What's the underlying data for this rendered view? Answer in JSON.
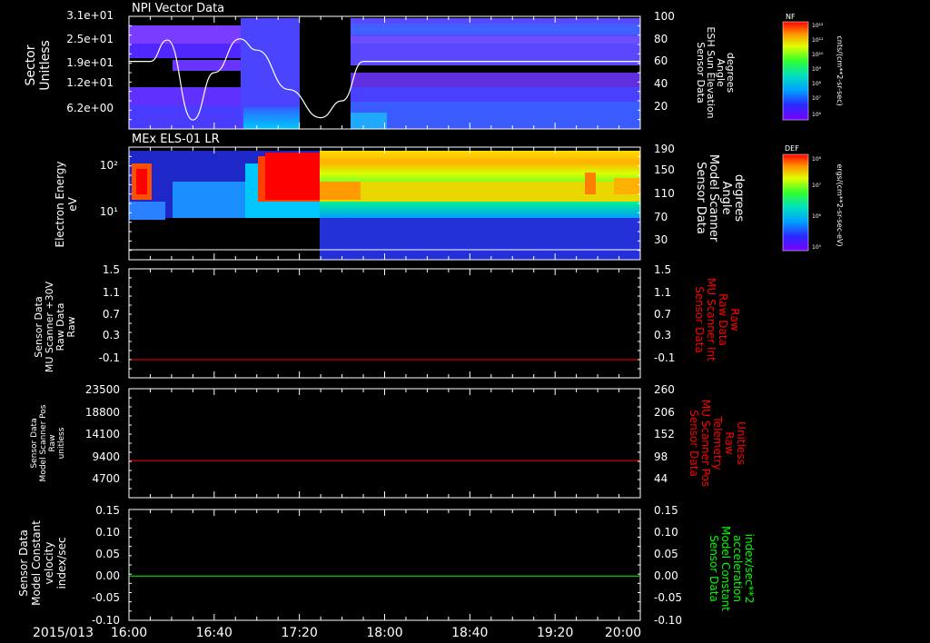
{
  "date_label": "2015/013",
  "time_ticks": [
    "16:00",
    "16:40",
    "17:20",
    "18:00",
    "18:40",
    "19:20",
    "20:00"
  ],
  "colors": {
    "white": "#ffffff",
    "red": "#ff0000",
    "green": "#00ff00",
    "background": "#000000"
  },
  "chart_data": [
    {
      "type": "heatmap",
      "title": "NPI Vector Data",
      "ylabel_left": [
        "Sector",
        "Unitless"
      ],
      "yticks_left": [
        "3.1e+01",
        "2.5e+01",
        "1.9e+01",
        "1.2e+01",
        "6.2e+00"
      ],
      "ylabel_right": [
        "Sensor Data",
        "ESH Sun Elevation",
        "Angle",
        "degrees"
      ],
      "yticks_right": [
        "100",
        "80",
        "60",
        "40",
        "20"
      ],
      "colorbar": {
        "label": "NF",
        "tick_labels": [
          "10¹²",
          "10¹¹",
          "10¹⁰",
          "10⁹",
          "10⁸",
          "10⁷",
          "10⁶"
        ],
        "units": "cnts/(cm**2-sr-sec)"
      },
      "overlay_line": {
        "name": "ESH Sun Elevation Angle",
        "x_time": [
          "16:00",
          "16:10",
          "16:18",
          "16:30",
          "16:40",
          "16:52",
          "17:00",
          "17:15",
          "17:30",
          "17:40",
          "17:50",
          "18:00",
          "20:00"
        ],
        "y_deg": [
          60,
          60,
          79,
          8,
          50,
          80,
          70,
          35,
          10,
          25,
          60,
          60,
          60
        ],
        "range": [
          0,
          100
        ]
      },
      "data_gap": {
        "start": "17:20",
        "end": "17:40"
      }
    },
    {
      "type": "heatmap",
      "title": "MEx ELS-01 LR",
      "ylabel_left": [
        "Electron Energy",
        "eV"
      ],
      "yticks_left": [
        "10²",
        "10¹"
      ],
      "ylabel_right": [
        "Sensor Data",
        "Model Scanner",
        "Angle",
        "degrees"
      ],
      "yticks_right": [
        "190",
        "150",
        "110",
        "70",
        "30"
      ],
      "colorbar": {
        "label": "DEF",
        "tick_labels": [
          "10⁸",
          "10⁷",
          "10⁶",
          "10⁵"
        ],
        "units": "ergs/(cm**2-sr-sec-eV)"
      },
      "overlay_line": {
        "name": "Model Scanner Angle",
        "value_deg": 20,
        "range": [
          0,
          190
        ]
      }
    },
    {
      "type": "line",
      "ylabel_left": [
        "Sensor Data",
        "MU Scanner +30V",
        "Raw Data",
        "Raw"
      ],
      "yticks_left": [
        "1.5",
        "1.1",
        "0.7",
        "0.3",
        "-0.1"
      ],
      "ylabel_right": [
        "Sensor Data",
        "MU Scanner Int",
        "Raw Data",
        "Raw"
      ],
      "yticks_right": [
        "1.5",
        "1.1",
        "0.7",
        "0.3",
        "-0.1"
      ],
      "ylim": [
        -0.3,
        1.5
      ],
      "series": [
        {
          "values_constant": 0.0,
          "color": "#ff0000"
        }
      ]
    },
    {
      "type": "line",
      "ylabel_left": [
        "Sensor Data",
        "Model Scanner Pos",
        "Raw",
        "unitless"
      ],
      "yticks_left": [
        "23500",
        "18800",
        "14100",
        "9400",
        "4700"
      ],
      "ylabel_right": [
        "Sensor Data",
        "MU Scanner Pos",
        "Telemetry",
        "Raw",
        "Unitless"
      ],
      "yticks_right": [
        "260",
        "206",
        "152",
        "98",
        "44"
      ],
      "ylim": [
        0,
        23500
      ],
      "series": [
        {
          "values_constant": 8000,
          "color": "#ff0000"
        }
      ]
    },
    {
      "type": "line",
      "ylabel_left": [
        "Sensor Data",
        "Model Constant",
        "velocity",
        "index/sec"
      ],
      "yticks_left": [
        "0.15",
        "0.10",
        "0.05",
        "0.00",
        "-0.05",
        "-0.10"
      ],
      "ylabel_right": [
        "Sensor Data",
        "Model Constant",
        "acceleration",
        "index/sec**2"
      ],
      "yticks_right": [
        "0.15",
        "0.10",
        "0.05",
        "0.00",
        "-0.05",
        "-0.10"
      ],
      "ylim": [
        -0.1,
        0.15
      ],
      "series": [
        {
          "values_constant": 0.0,
          "color": "#00ff00"
        }
      ]
    }
  ]
}
